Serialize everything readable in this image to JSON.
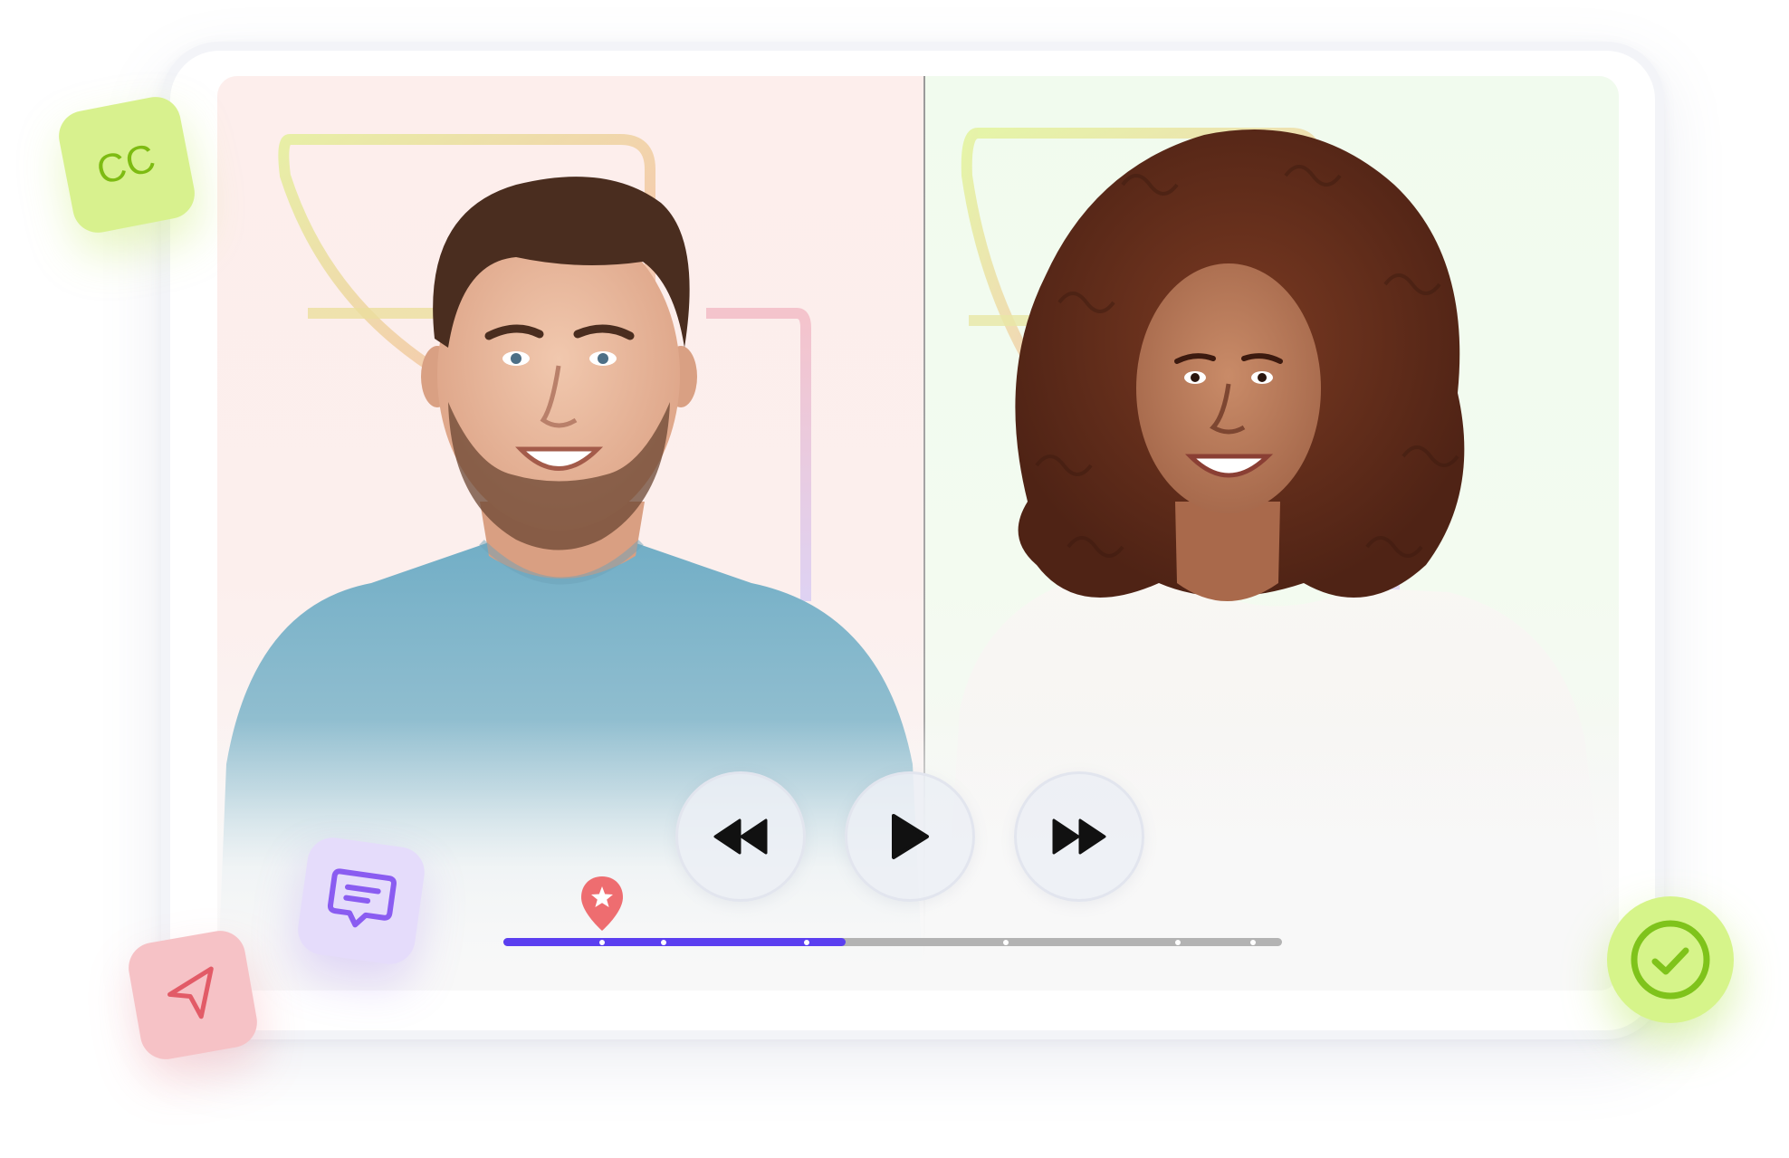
{
  "player": {
    "participants": [
      {
        "name": "",
        "panel_color": "#fdeeec",
        "shirt_color": "#7fb3c8"
      },
      {
        "name": "",
        "panel_color": "#f1fbee",
        "shirt_color": "#f5f3ef"
      }
    ],
    "controls": {
      "rewind_icon": "rewind-icon",
      "play_icon": "play-icon",
      "fast_forward_icon": "fast-forward-icon"
    },
    "timeline": {
      "progress": 0.44,
      "bookmark_position": 0.127,
      "bookmark_icon": "star-pin-icon",
      "markers": [
        0.127,
        0.206,
        0.389,
        0.645,
        0.866,
        0.963
      ],
      "played_color": "#5b3ff0",
      "remaining_color": "#b3b3b3"
    }
  },
  "badges": {
    "captions": {
      "label": "CC",
      "color": "#d8f18e",
      "text_color": "#7dbb12"
    },
    "comment": {
      "icon": "chat-message-icon",
      "color": "#e5dcfb"
    },
    "send": {
      "icon": "send-arrow-icon",
      "color": "#f6c2c6"
    },
    "approve": {
      "icon": "check-circle-icon",
      "color": "#d6f48a"
    }
  }
}
